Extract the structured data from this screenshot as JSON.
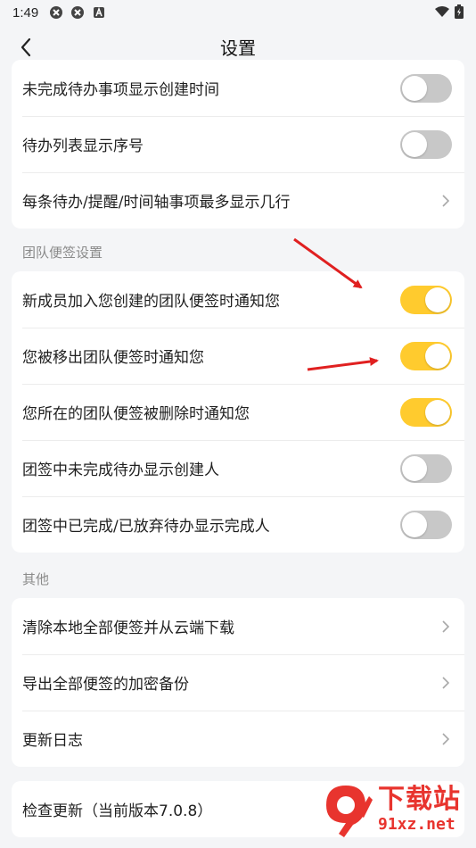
{
  "status_bar": {
    "time": "1:49"
  },
  "header": {
    "title": "设置"
  },
  "card1": {
    "rows": [
      {
        "label": "未完成待办事项显示创建时间",
        "toggle": "off"
      },
      {
        "label": "待办列表显示序号",
        "toggle": "off"
      },
      {
        "label": "每条待办/提醒/时间轴事项最多显示几行"
      }
    ]
  },
  "team_section": {
    "title": "团队便签设置",
    "rows": [
      {
        "label": "新成员加入您创建的团队便签时通知您",
        "toggle": "on"
      },
      {
        "label": "您被移出团队便签时通知您",
        "toggle": "on"
      },
      {
        "label": "您所在的团队便签被删除时通知您",
        "toggle": "on"
      },
      {
        "label": "团签中未完成待办显示创建人",
        "toggle": "off"
      },
      {
        "label": "团签中已完成/已放弃待办显示完成人",
        "toggle": "off"
      }
    ]
  },
  "other_section": {
    "title": "其他",
    "rows": [
      {
        "label": "清除本地全部便签并从云端下载"
      },
      {
        "label": "导出全部便签的加密备份"
      },
      {
        "label": "更新日志"
      }
    ]
  },
  "update_card": {
    "label": "检查更新（当前版本7.0.8）"
  },
  "watermark": {
    "title": "下载站",
    "url": "91xz.net"
  },
  "colors": {
    "accent": "#ffcb2e",
    "toggle_off": "#c8c8c8",
    "arrow": "#e02020",
    "watermark": "#e8342e"
  }
}
